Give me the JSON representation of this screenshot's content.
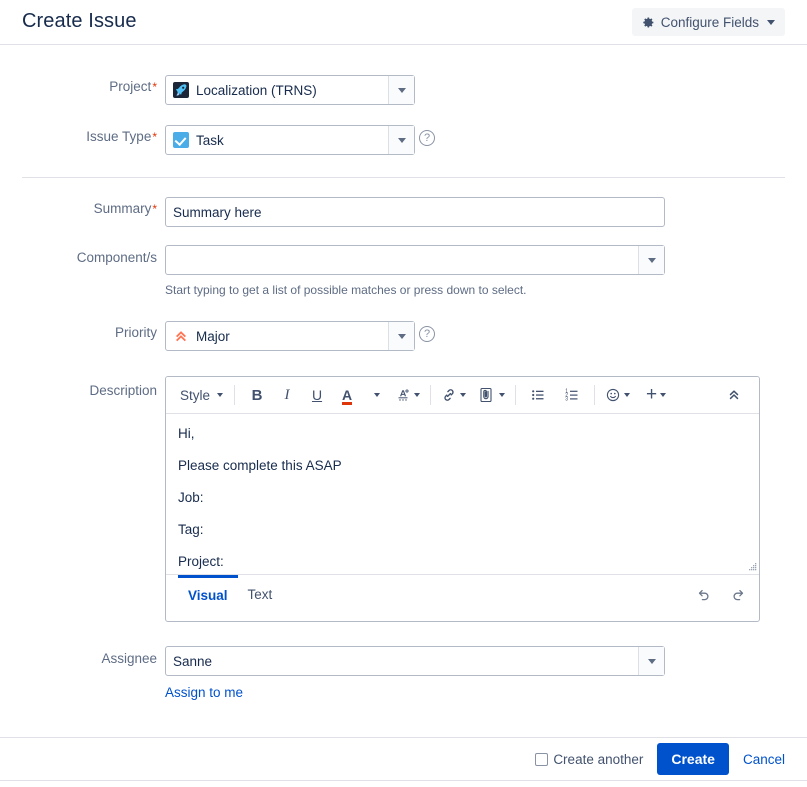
{
  "header": {
    "title": "Create Issue",
    "configure_fields_label": "Configure Fields",
    "gear_icon": "gear-icon",
    "caret_icon": "chevron-down-icon"
  },
  "form": {
    "project": {
      "label": "Project",
      "required": "*",
      "value": "Localization (TRNS)",
      "icon": "rocket-project-icon"
    },
    "issue_type": {
      "label": "Issue Type",
      "required": "*",
      "value": "Task",
      "icon": "task-checkbox-icon",
      "help_icon": "help-question-icon"
    },
    "summary": {
      "label": "Summary",
      "required": "*",
      "value": "Summary here",
      "placeholder": ""
    },
    "components": {
      "label": "Component/s",
      "value": "",
      "placeholder": "",
      "hint": "Start typing to get a list of possible matches or press down to select."
    },
    "priority": {
      "label": "Priority",
      "value": "Major",
      "icon": "priority-major-icon",
      "help_icon": "help-question-icon"
    },
    "description": {
      "label": "Description",
      "toolbar": {
        "style_label": "Style",
        "bold": "B",
        "italic": "I",
        "underline": "U",
        "text_color": "A",
        "buttons": [
          {
            "name": "style-dropdown",
            "label": "Style"
          },
          {
            "name": "bold-button",
            "label": "B"
          },
          {
            "name": "italic-button",
            "label": "I"
          },
          {
            "name": "underline-button",
            "label": "U"
          },
          {
            "name": "text-color-button",
            "label": "A"
          },
          {
            "name": "text-effects-button",
            "label": ""
          },
          {
            "name": "link-button",
            "label": ""
          },
          {
            "name": "attachment-button",
            "label": ""
          },
          {
            "name": "bullet-list-button",
            "label": ""
          },
          {
            "name": "numbered-list-button",
            "label": ""
          },
          {
            "name": "emoji-button",
            "label": ""
          },
          {
            "name": "insert-more-button",
            "label": "+"
          },
          {
            "name": "collapse-toolbar-button",
            "label": ""
          }
        ]
      },
      "content_lines": [
        "Hi,",
        "Please complete this ASAP",
        "Job:",
        "Tag:",
        "Project:"
      ],
      "tabs": [
        {
          "label": "Visual",
          "active": true
        },
        {
          "label": "Text",
          "active": false
        }
      ],
      "undo_icon": "undo-icon",
      "redo_icon": "redo-icon",
      "resize_icon": "resize-grip-icon"
    },
    "assignee": {
      "label": "Assignee",
      "value": "Sanne",
      "assign_to_me_link": "Assign to me"
    }
  },
  "footer": {
    "create_another_label": "Create another",
    "create_another_checked": false,
    "create_label": "Create",
    "cancel_label": "Cancel"
  },
  "colors": {
    "primary": "#0052cc",
    "required_star": "#de350b",
    "label_text": "#5e6c84",
    "body_text": "#172b4d",
    "border": "#b3bac5",
    "divider": "#dfe1e6",
    "priority_major": "#ff7452",
    "task_icon_bg": "#4bade8",
    "project_icon_bg": "#1b2638"
  }
}
